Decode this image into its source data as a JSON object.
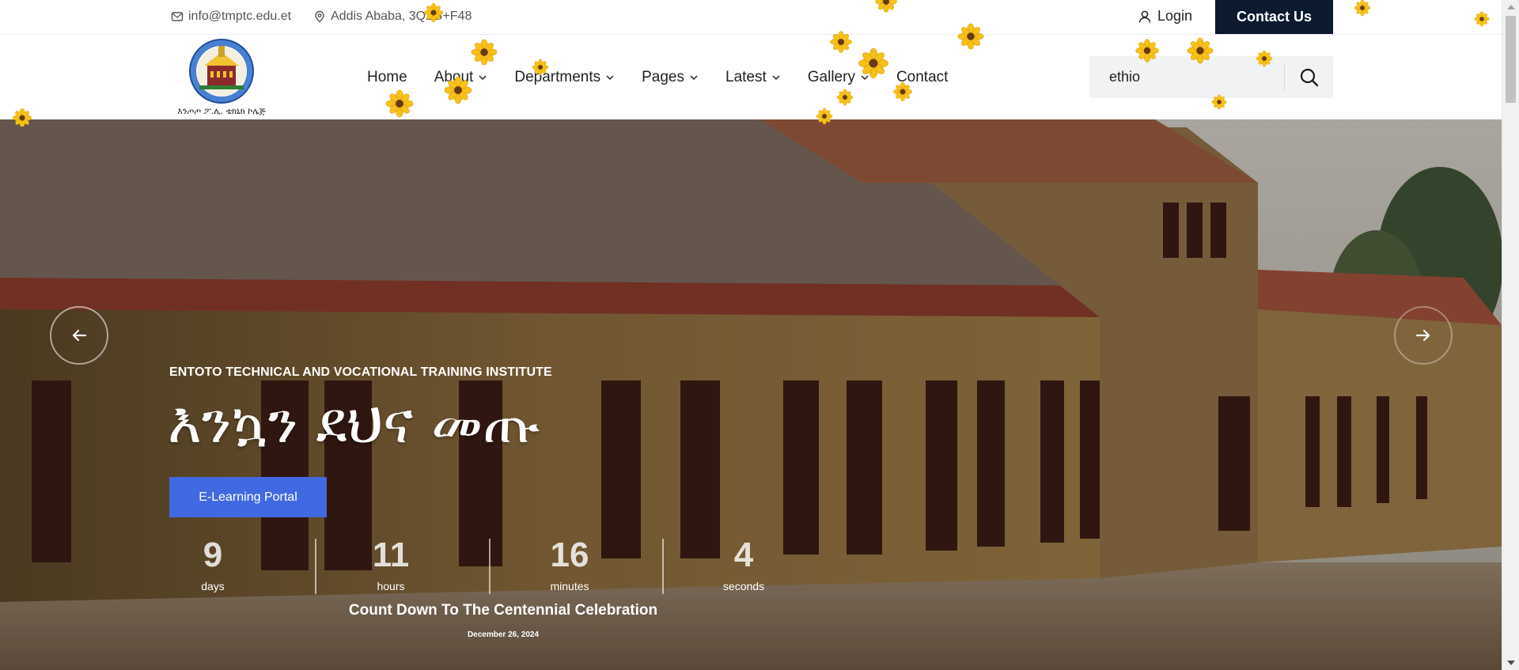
{
  "topbar": {
    "email": "info@tmptc.edu.et",
    "address": "Addis Ababa, 3Q2G+F48",
    "login_label": "Login",
    "contact_label": "Contact Us",
    "icons": [
      "mail-icon",
      "map-pin-icon",
      "user-icon"
    ]
  },
  "logo": {
    "amharic_text": "እንጦጦ ፖ.ሊ. ቴክኒክ ኮሌጅ"
  },
  "nav": {
    "items": [
      {
        "label": "Home",
        "dropdown": false
      },
      {
        "label": "About",
        "dropdown": true
      },
      {
        "label": "Departments",
        "dropdown": true
      },
      {
        "label": "Pages",
        "dropdown": true
      },
      {
        "label": "Latest",
        "dropdown": true
      },
      {
        "label": "Gallery",
        "dropdown": true
      },
      {
        "label": "Contact",
        "dropdown": false
      }
    ]
  },
  "search": {
    "value": "ethio",
    "icon": "search-icon"
  },
  "hero": {
    "eyebrow": "ENTOTO TECHNICAL AND VOCATIONAL TRAINING INSTITUTE",
    "headline": "እንኳን ደህና መጡ",
    "cta_label": "E-Learning Portal",
    "countdown": {
      "units": [
        {
          "value": "9",
          "label": "days"
        },
        {
          "value": "11",
          "label": "hours"
        },
        {
          "value": "16",
          "label": "minutes"
        },
        {
          "value": "4",
          "label": "seconds"
        }
      ],
      "title": "Count Down To The Centennial Celebration",
      "date": "December 26, 2024"
    }
  },
  "colors": {
    "contact_button": "#0b1a2e",
    "cta_button": "#4169e1",
    "search_bg": "#f1f2f4"
  }
}
